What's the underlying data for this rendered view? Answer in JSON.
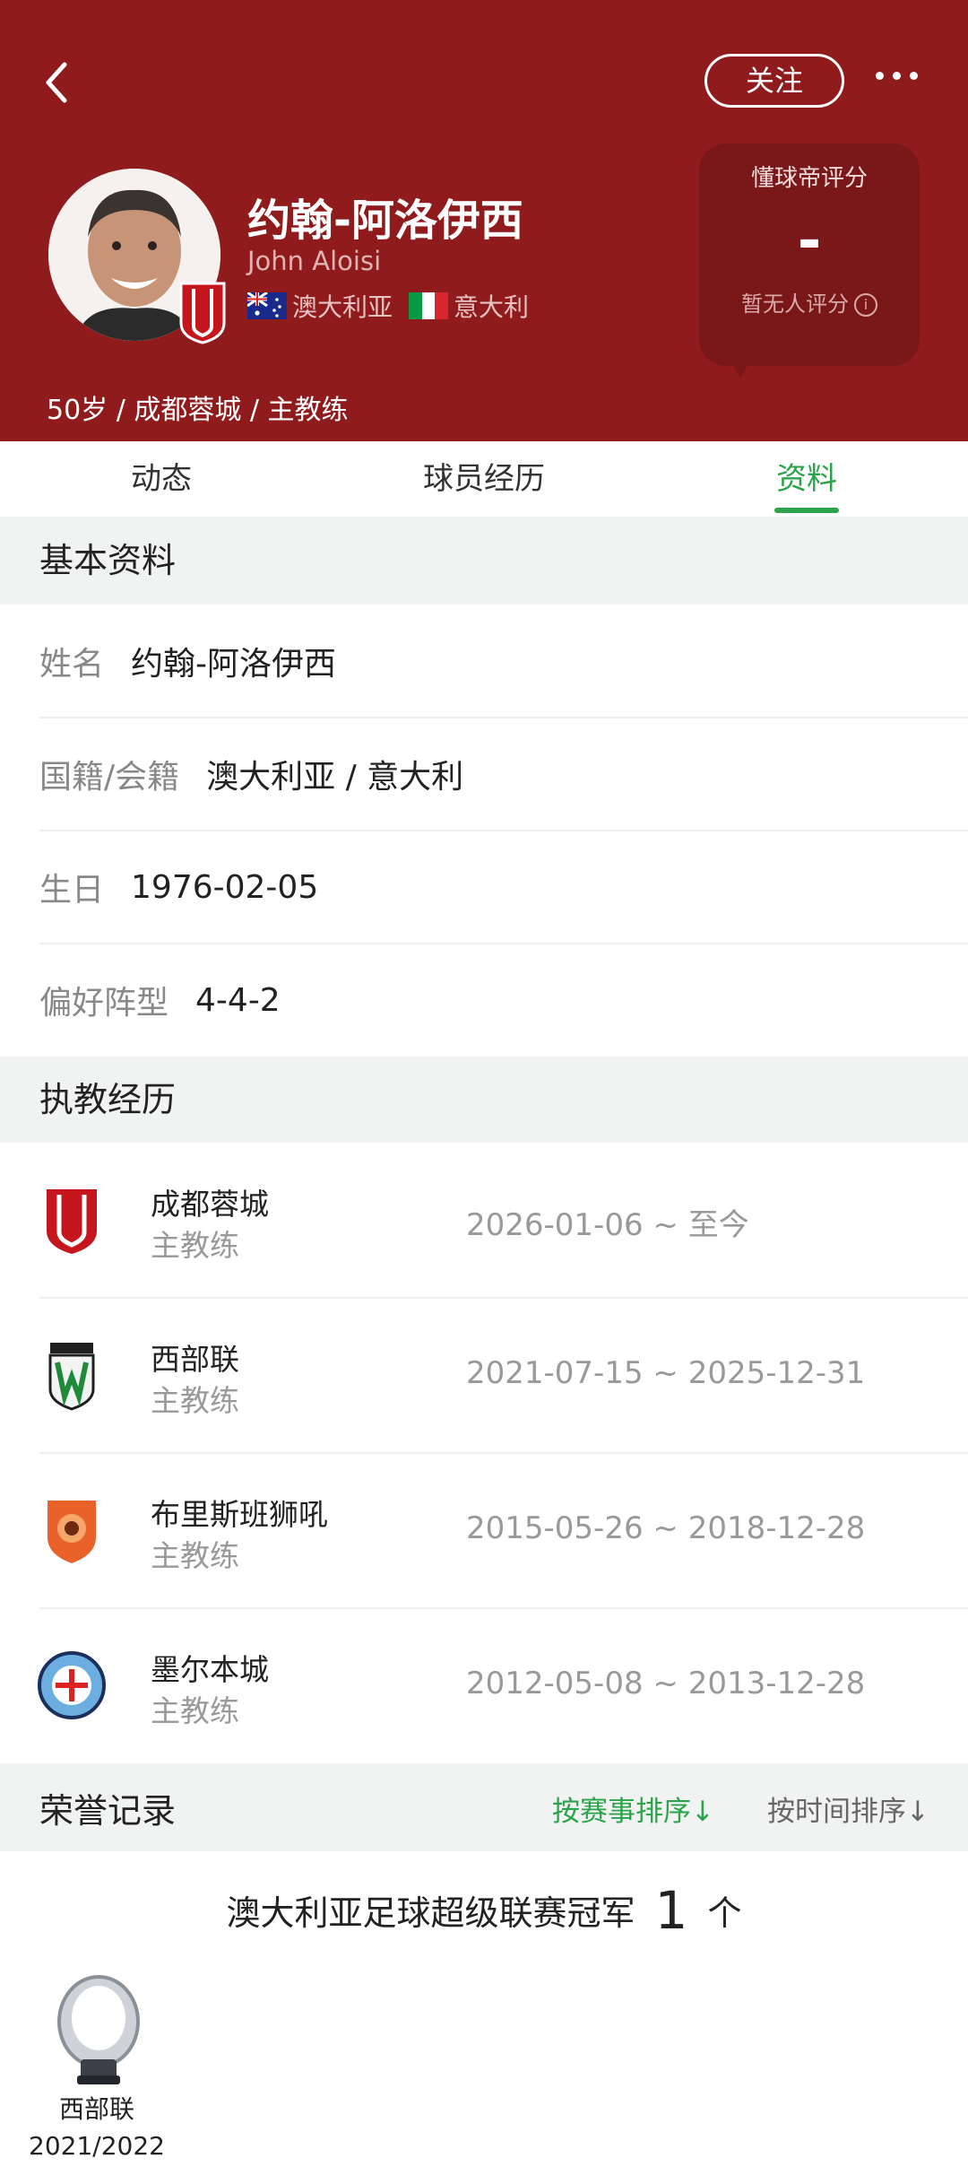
{
  "header": {
    "follow_label": "关注",
    "name_cn": "约翰-阿洛伊西",
    "name_en": "John Aloisi",
    "nationalities": [
      "澳大利亚",
      "意大利"
    ],
    "meta_line": "50岁 / 成都蓉城 / 主教练",
    "rating": {
      "title": "懂球帝评分",
      "value": "-",
      "none_label": "暂无人评分",
      "info_icon": "i"
    }
  },
  "tabs": [
    {
      "label": "动态",
      "active": false
    },
    {
      "label": "球员经历",
      "active": false
    },
    {
      "label": "资料",
      "active": true
    }
  ],
  "basic_info": {
    "title": "基本资料",
    "rows": [
      {
        "label": "姓名",
        "value": "约翰-阿洛伊西"
      },
      {
        "label": "国籍/会籍",
        "value": "澳大利亚 / 意大利"
      },
      {
        "label": "生日",
        "value": "1976-02-05"
      },
      {
        "label": "偏好阵型",
        "value": "4-4-2"
      }
    ]
  },
  "coaching": {
    "title": "执教经历",
    "items": [
      {
        "club": "成都蓉城",
        "role": "主教练",
        "dates": "2026-01-06 ~ 至今",
        "logo": "chengdu-rongcheng-logo"
      },
      {
        "club": "西部联",
        "role": "主教练",
        "dates": "2021-07-15 ~ 2025-12-31",
        "logo": "western-united-logo"
      },
      {
        "club": "布里斯班狮吼",
        "role": "主教练",
        "dates": "2015-05-26 ~ 2018-12-28",
        "logo": "brisbane-roar-logo"
      },
      {
        "club": "墨尔本城",
        "role": "主教练",
        "dates": "2012-05-08 ~ 2013-12-28",
        "logo": "melbourne-city-logo"
      }
    ]
  },
  "honors": {
    "title": "荣誉记录",
    "sort_by_competition": "按赛事排序↓",
    "sort_by_time": "按时间排序↓",
    "competition": "澳大利亚足球超级联赛冠军",
    "count": "1",
    "count_unit": "个",
    "trophies": [
      {
        "club": "西部联",
        "season": "2021/2022"
      }
    ]
  },
  "colors": {
    "header_bg": "#8f1b1d",
    "accent_green": "#2aa34a",
    "section_bg": "#f1f2f2"
  }
}
